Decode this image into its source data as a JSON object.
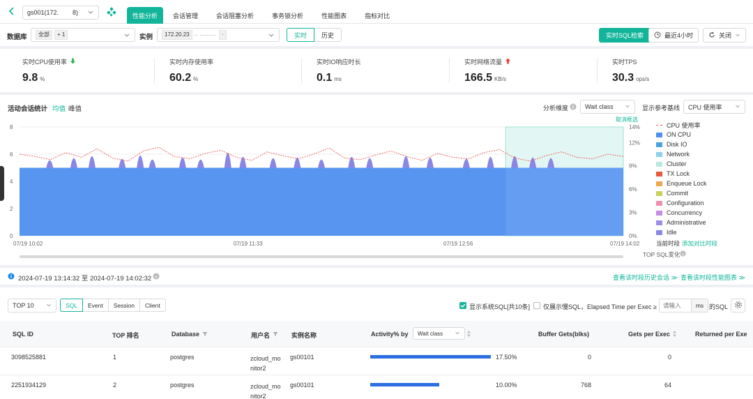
{
  "top_bar": {
    "instance_select": "gs001(172.        8)",
    "tabs": [
      "性能分析",
      "会话管理",
      "会话阻塞分析",
      "事务锁分析",
      "性能图表",
      "指标对比"
    ],
    "active_tab": 0
  },
  "filter_bar": {
    "db_label": "数据库",
    "db_chips": [
      "全部",
      "+ 1"
    ],
    "instance_label": "实例",
    "instance_chips": [
      "172.20.23",
      "·· ·········",
      "·"
    ],
    "mode_realtime": "实时",
    "mode_history": "历史",
    "sql_search_button": "实时SQL检索",
    "time_range_button": "最近4小时",
    "refresh_select": "关闭"
  },
  "kpis": [
    {
      "label": "实时CPU使用率",
      "value": "9.8",
      "unit": "%",
      "trend": "down"
    },
    {
      "label": "实时内存使用率",
      "value": "60.2",
      "unit": "%",
      "trend": ""
    },
    {
      "label": "实时IO响应时长",
      "value": "0.1",
      "unit": "ms",
      "trend": ""
    },
    {
      "label": "实时网络流量",
      "value": "166.5",
      "unit": "KB/s",
      "trend": "up"
    },
    {
      "label": "实时TPS",
      "value": "30.3",
      "unit": "ops/s",
      "trend": ""
    }
  ],
  "chart_panel": {
    "title": "活动会话统计",
    "toggle_avg": "均值",
    "toggle_peak": "峰值",
    "dimension_label": "分析维度",
    "dimension_value": "Wait class",
    "baseline_label": "显示参考基线",
    "baseline_value": "CPU 使用率",
    "cancel_selection": "取消框选",
    "current_period": "当前时段",
    "add_compare": "添加对比时段",
    "top_sql_change": "TOP SQL变化"
  },
  "chart_data": {
    "type": "area",
    "x_ticks": [
      "07/19 10:02",
      "07/19 11:33",
      "07/19 12:56",
      "07/19 14:02"
    ],
    "y_left_ticks": [
      "0",
      "2",
      "4",
      "6",
      "8"
    ],
    "y_right_ticks": [
      "0%",
      "3%",
      "6%",
      "9%",
      "12%",
      "14%"
    ],
    "ylim_left": [
      0,
      8
    ],
    "ylim_right": [
      0,
      14
    ],
    "baseline_on_cpu": 5,
    "spikes_idle": [
      0.05,
      0.09,
      0.12,
      0.17,
      0.2,
      0.22,
      0.27,
      0.3,
      0.345,
      0.37,
      0.42,
      0.46,
      0.5,
      0.55,
      0.58,
      0.64,
      0.68,
      0.74,
      0.78,
      0.82,
      0.85,
      0.88
    ],
    "spike_heights": [
      0.9,
      1.2,
      1.5,
      1.1,
      1.6,
      1.0,
      1.3,
      1.0,
      2.0,
      1.4,
      1.2,
      1.3,
      1.0,
      1.4,
      1.2,
      1.5,
      1.3,
      1.1,
      1.4,
      1.5,
      1.3,
      1.2
    ],
    "cpu_line_pct": [
      10.5,
      10.2,
      9.8,
      10.7,
      10.1,
      11.2,
      10.0,
      9.6,
      10.9,
      11.4,
      10.2,
      9.9,
      10.6,
      11.0,
      10.1,
      9.7,
      10.8,
      10.3,
      9.9,
      10.5,
      11.3,
      10.0,
      9.8,
      10.4,
      10.9,
      10.2,
      9.7,
      10.6,
      10.1,
      9.9,
      10.7,
      11.1,
      10.0,
      9.6,
      10.3,
      10.8,
      10.1,
      9.9,
      10.5,
      10.2
    ],
    "selection_start": 0.805,
    "legend": [
      {
        "name": "CPU 使用率",
        "color": "#ee5555",
        "dashed": true
      },
      {
        "name": "ON CPU",
        "color": "#4f8ff0"
      },
      {
        "name": "Disk IO",
        "color": "#4aa3df"
      },
      {
        "name": "Network",
        "color": "#8fd0ec"
      },
      {
        "name": "Cluster",
        "color": "#b9e8de"
      },
      {
        "name": "TX Lock",
        "color": "#e55a3a"
      },
      {
        "name": "Enqueue Lock",
        "color": "#f0a64a"
      },
      {
        "name": "Commit",
        "color": "#c8d25a"
      },
      {
        "name": "Configuration",
        "color": "#ef8fb0"
      },
      {
        "name": "Concurrency",
        "color": "#c58ee0"
      },
      {
        "name": "Administrative",
        "color": "#9d8ee8"
      },
      {
        "name": "Idle",
        "color": "#8a86e6"
      }
    ]
  },
  "range_bar": {
    "range_text": "2024-07-19 13:14:32 至 2024-07-19 14:02:32",
    "view_sessions": "查看该时段历史会话 ≫",
    "view_charts": "查看该时段性能图表 ≫"
  },
  "table_toolbar": {
    "top_select": "TOP 10",
    "segments": [
      "SQL",
      "Event",
      "Session",
      "Client"
    ],
    "show_system_sql": "显示系统SQL[共10条]",
    "slow_sql_only": "仅展示慢SQL，Elapsed Time per Exec ≥",
    "input_placeholder": "请输入",
    "ms_unit": "ms",
    "sql_suffix": "的SQL"
  },
  "table": {
    "headers": [
      "SQL ID",
      "TOP 排名",
      "Database",
      "用户名",
      "实例名称",
      "Activity% by",
      "Buffer Gets(blks)",
      "Gets per Exec",
      "Returned per Exe"
    ],
    "activity_select": "Wait class",
    "rows": [
      {
        "sql_id": "3098525881",
        "rank": "1",
        "database": "postgres",
        "user_line1": "zcloud_mo",
        "user_line2": "nitor2",
        "instance": "gs00101",
        "activity": "17.50%",
        "activity_frac": 1.0,
        "buffer_gets": "0",
        "gets_per_exec": "0"
      },
      {
        "sql_id": "2251934129",
        "rank": "2",
        "database": "postgres",
        "user_line1": "zcloud_mo",
        "user_line2": "nitor2",
        "instance": "gs00101",
        "activity": "10.00%",
        "activity_frac": 0.57,
        "buffer_gets": "768",
        "gets_per_exec": "64"
      }
    ]
  }
}
